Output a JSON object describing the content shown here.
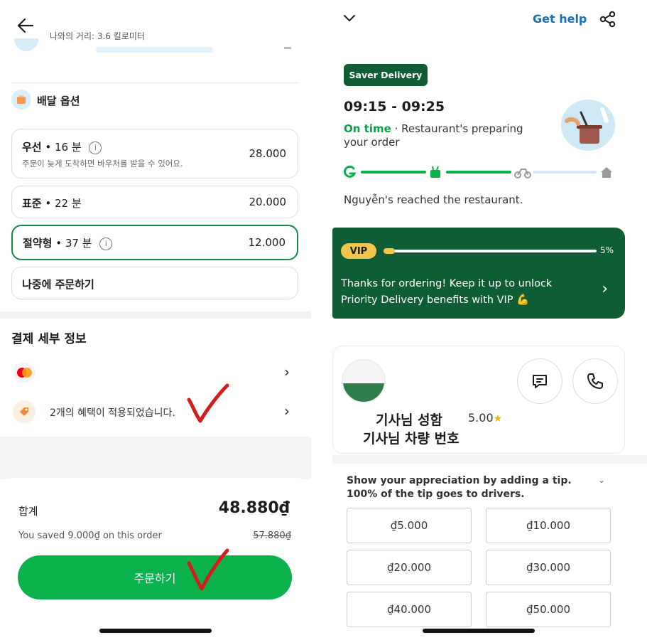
{
  "left": {
    "header": {
      "distance": "나와의 거리: 3.6 킬로미터"
    },
    "delivery_options": {
      "title": "배달 옵션",
      "options": [
        {
          "name": "우선",
          "time": "16 분",
          "price": "28.000",
          "note": "주문이 늦게 도착하면 바우처를 받을 수 있어요.",
          "info": "i"
        },
        {
          "name": "표준",
          "time": "22 분",
          "price": "20.000"
        },
        {
          "name": "절약형",
          "time": "37 분",
          "price": "12.000",
          "info": "i",
          "selected": true
        },
        {
          "name": "나중에 주문하기"
        }
      ]
    },
    "payment": {
      "title": "결제 세부 정보",
      "card_icon": "mastercard-icon",
      "promo_text": "2개의 혜택이 적용되었습니다.",
      "chevron": "›"
    },
    "summary": {
      "total_label": "합계",
      "total_amount": "48.880₫",
      "saved_text": "You saved 9.000₫ on this order",
      "original_amount": "57.880₫",
      "order_button": "주문하기"
    },
    "accent_green": "#0bb24c",
    "annotation_color": "#d31c1c"
  },
  "right": {
    "header": {
      "get_help": "Get help"
    },
    "saver_badge": "Saver Delivery",
    "eta": "09:15 - 09:25",
    "status": {
      "on_time": "On time",
      "separator": " · ",
      "text": "Restaurant's preparing your order"
    },
    "progress": {
      "steps": [
        "grab-icon",
        "food-icon",
        "bike-icon",
        "home-icon"
      ],
      "completed_segments": 2
    },
    "reached_text": "Nguyễn's reached the restaurant.",
    "vip": {
      "badge": "VIP",
      "percent_label": "5%",
      "progress_fraction": 0.05,
      "message": "Thanks for ordering! Keep it up to unlock Priority Delivery benefits with VIP 💪",
      "chevron": "›"
    },
    "driver": {
      "name": "기사님 성함",
      "rating": "5.00",
      "star": "★",
      "plate": "기사님 차량 번호"
    },
    "tip": {
      "text": "Show your appreciation by adding a tip. 100% of the tip goes to drivers.",
      "chevron": "⌄",
      "amounts": [
        "₫5.000",
        "₫10.000",
        "₫20.000",
        "₫30.000",
        "₫40.000",
        "₫50.000"
      ]
    },
    "brand_dark_green": "#0f5d34",
    "link_blue": "#1a6fb5"
  }
}
